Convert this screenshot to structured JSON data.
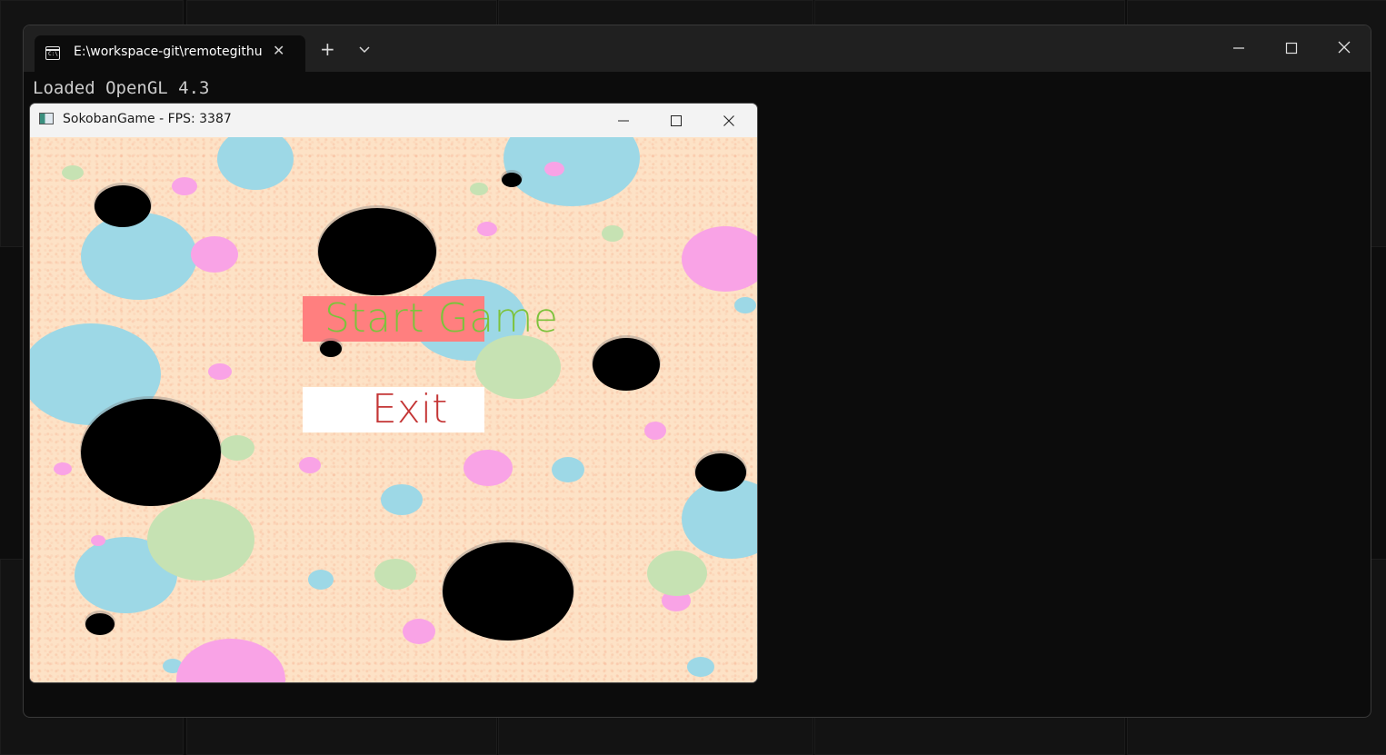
{
  "terminal": {
    "tab_title": "E:\\workspace-git\\remotegithu",
    "tab_icon_text": "C:\\",
    "output_line": "Loaded OpenGL 4.3"
  },
  "game_window": {
    "title": "SokobanGame - FPS: 3387"
  },
  "menu": {
    "start_label": "Start Game",
    "exit_label": "Exit"
  },
  "colors": {
    "start_bg": "#ff7f7f",
    "start_text": "#7dc23c",
    "exit_bg": "#ffffff",
    "exit_text": "#c43535",
    "canvas_bg": "#fde2c6"
  }
}
